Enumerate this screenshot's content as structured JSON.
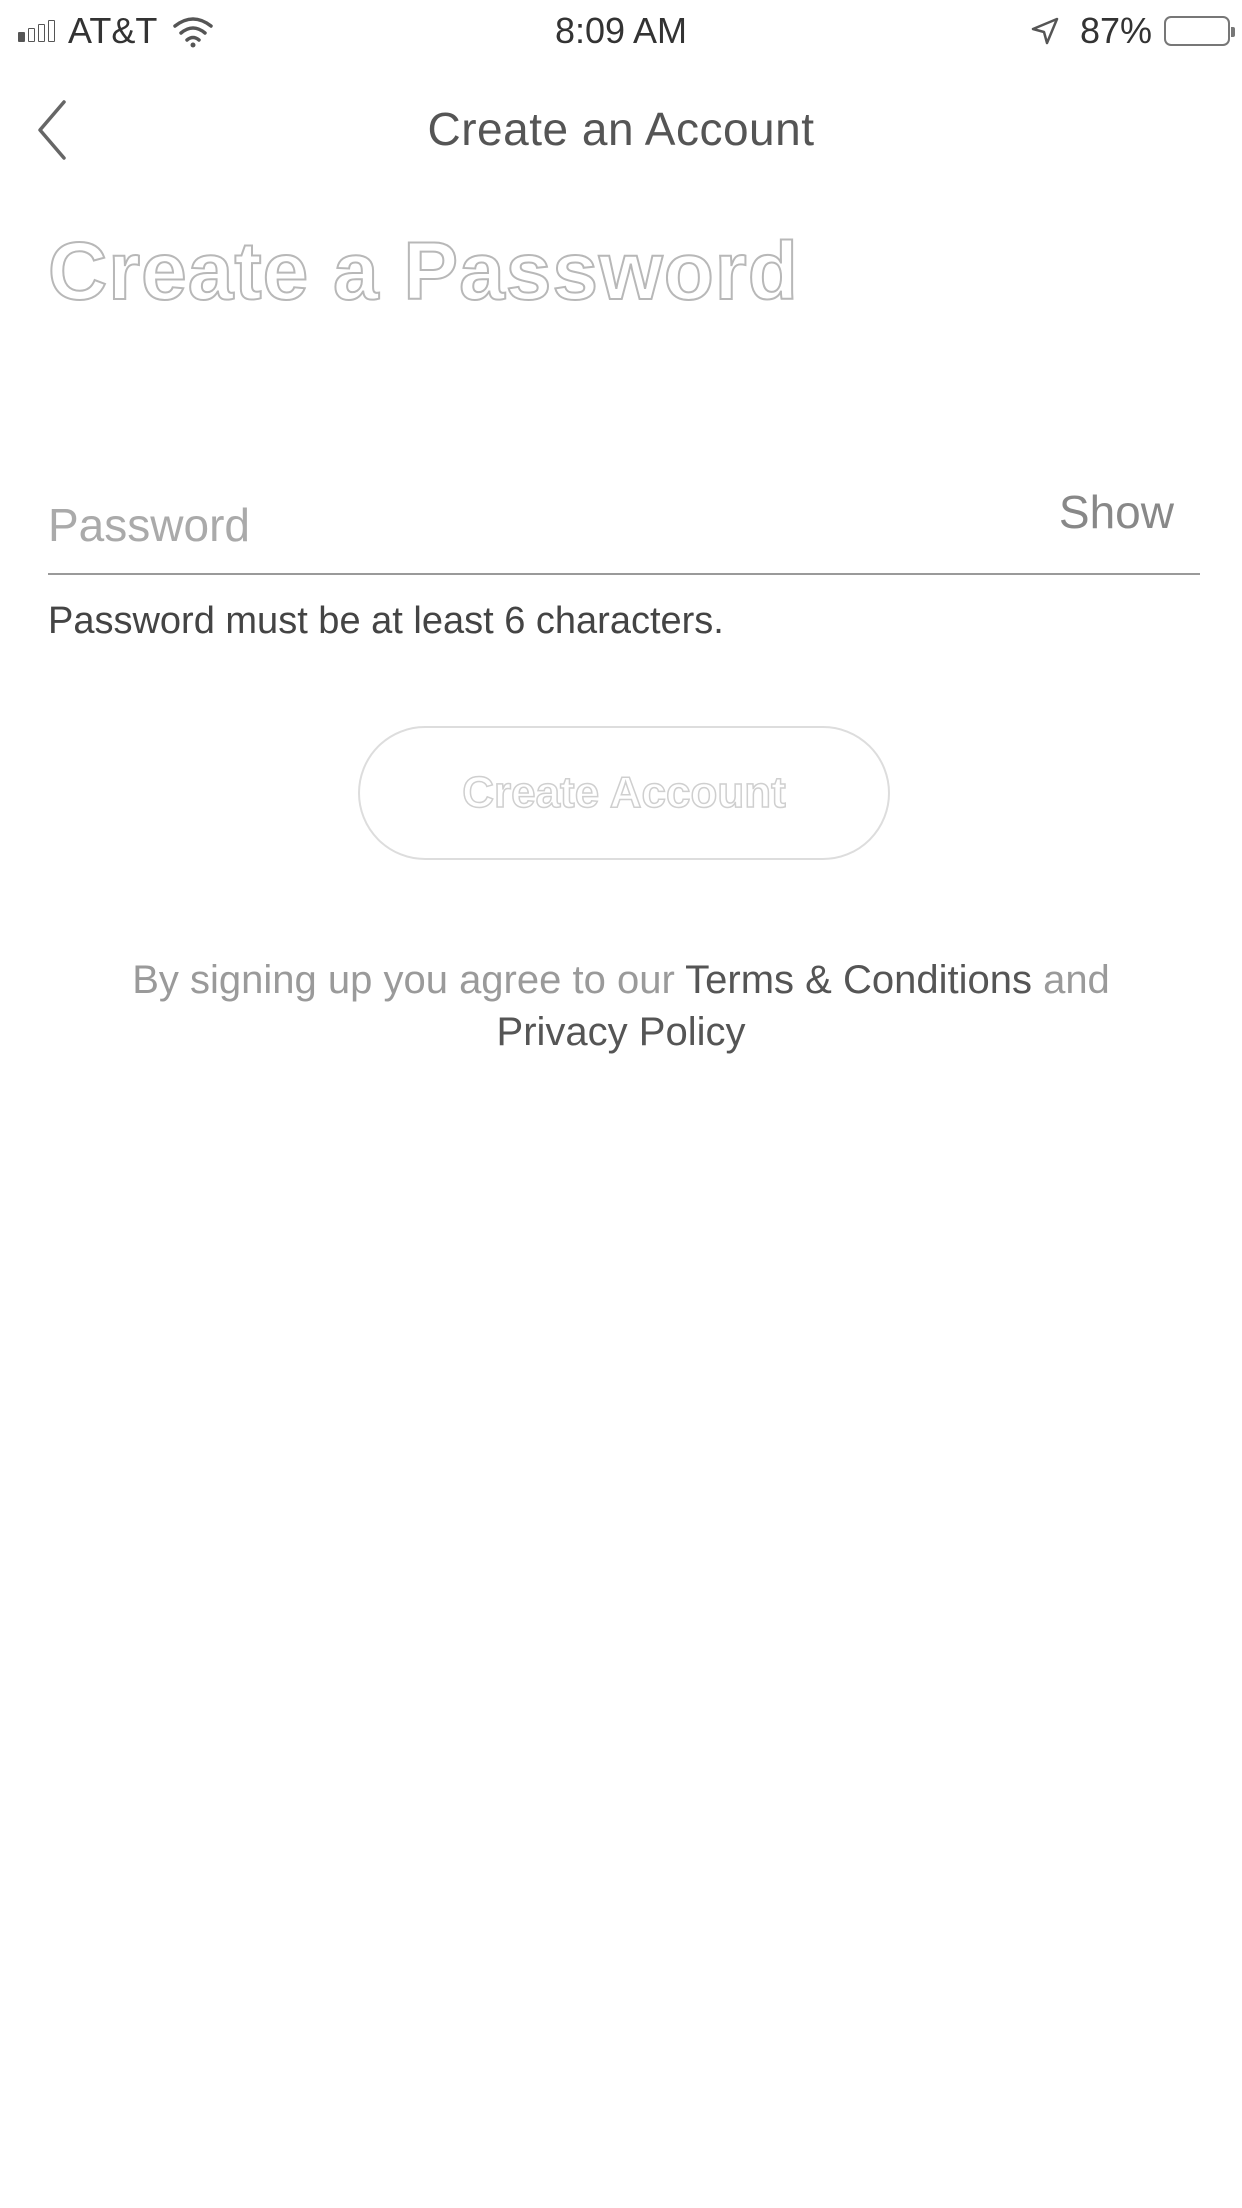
{
  "status_bar": {
    "carrier": "AT&T",
    "time": "8:09 AM",
    "battery_percent": "87%",
    "battery_level": 0.87,
    "signal_bars_filled": 1,
    "signal_bars_total": 4
  },
  "nav": {
    "title": "Create an Account",
    "back_icon": "chevron-left-icon"
  },
  "main": {
    "heading": "Create a Password",
    "password_field": {
      "placeholder": "Password",
      "value": "",
      "show_label": "Show"
    },
    "hint": "Password must be at least 6 characters.",
    "create_button_label": "Create Account"
  },
  "legal": {
    "prefix": "By signing up you agree to our ",
    "terms_link": "Terms & Conditions",
    "conjunction": " and ",
    "privacy_link": "Privacy Policy"
  },
  "colors": {
    "link": "#555555",
    "muted_text": "#9a9a9a",
    "outline": "#b8b8b8"
  }
}
